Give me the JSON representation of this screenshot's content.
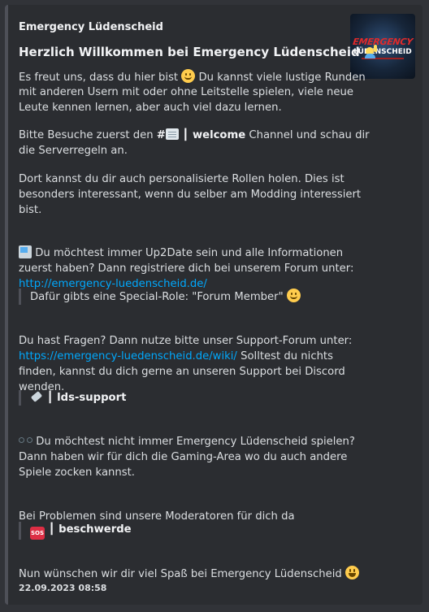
{
  "embed": {
    "author": "Emergency Lüdenscheid",
    "title": "Herzlich Willkommen bei Emergency Lüdenscheid",
    "thumbnail": {
      "logo_line1": "EMERGENCY",
      "logo_line2": "LÜDENSCHEID"
    },
    "intro": {
      "line1": "Es freut uns, dass du hier bist",
      "line1_end": "Du kannst viele lustige Runden",
      "line2": "mit anderen Usern mit oder ohne Leitstelle spielen, viele neue",
      "line3": "Leute kennen lernen, aber auch viel dazu lernen."
    },
    "welcome": {
      "prefix": "Bitte Besuche zuerst den",
      "channel": "welcome",
      "suffix": "Channel und schau dir",
      "line2": "die Serverregeln an."
    },
    "roles": {
      "line1": "Dort kannst du dir auch personalisierte Rollen holen. Dies ist",
      "line2": "besonders interessant, wenn du selber am Modding interessiert",
      "line3": "bist."
    },
    "forum": {
      "line1": "Du möchtest immer Up2Date sein und alle Informationen",
      "line2": "zuerst haben? Dann registriere dich bei unserem Forum unter:",
      "link": "http://emergency-luedenscheid.de/",
      "quote": "Dafür gibts eine Special-Role: \"Forum Member\""
    },
    "support": {
      "line1": "Du hast Fragen? Dann nutze bitte unser Support-Forum unter:",
      "link": "https://emergency-luedenscheid.de/wiki/",
      "line2_end": "Solltest du nichts",
      "line3": "finden, kannst du dich gerne an unseren Support bei Discord",
      "line4": "wenden.",
      "channel": "lds-support"
    },
    "gaming": {
      "line1": "Du möchtest nicht immer Emergency Lüdenscheid spielen?",
      "line2": "Dann haben wir für dich die Gaming-Area wo du auch andere",
      "line3": "Spiele zocken kannst."
    },
    "moderation": {
      "line1": "Bei Problemen sind unsere Moderatoren für dich da",
      "channel": "beschwerde"
    },
    "closing": "Nun wünschen wir dir viel Spaß bei Emergency Lüdenscheid",
    "timestamp": "22.09.2023 08:58",
    "colors": {
      "link": "#00a8fc",
      "border": "#4e5058",
      "background": "#2b2d31"
    }
  }
}
